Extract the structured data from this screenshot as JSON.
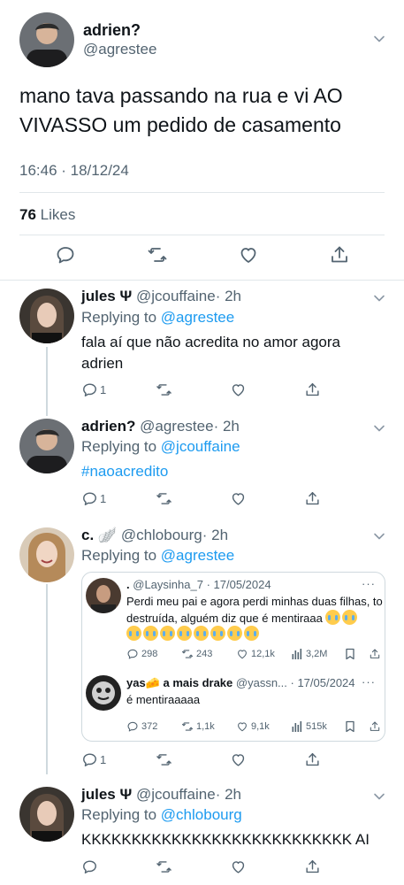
{
  "colors": {
    "link": "#1d9bf0",
    "secondary_text": "#536471",
    "primary_text": "#0f1419",
    "divider": "#e1e6ea"
  },
  "main_tweet": {
    "author_name": "adrien?",
    "author_handle": "@agrestee",
    "text": "mano tava passando na rua e vi AO VIVASSO um pedido de casamento",
    "timestamp": "16:46 · 18/12/24",
    "likes_count": "76",
    "likes_label": "Likes",
    "actions": [
      "reply-icon",
      "retweet-icon",
      "like-icon",
      "share-icon"
    ]
  },
  "replies": [
    {
      "name": "jules Ψ",
      "handle": "@jcouffaine",
      "time": "· 2h",
      "replying_label": "Replying to",
      "replying_to": "@agrestee",
      "text": "fala aí que não acredita no amor agora adrien",
      "reply_count": "1"
    },
    {
      "name": "adrien?",
      "handle": "@agrestee",
      "time": "· 2h",
      "replying_label": "Replying to",
      "replying_to": "@jcouffaine",
      "text": "#naoacredito",
      "reply_count": "1"
    },
    {
      "name": "c. 🪽",
      "handle": "@chlobourg",
      "time": "· 2h",
      "replying_label": "Replying to",
      "replying_to": "@agrestee",
      "reply_count": "1",
      "quote": {
        "first": {
          "name": ".",
          "handle": "@Laysinha_7",
          "date": "· 17/05/2024",
          "text": "Perdi meu pai e agora perdi minhas duas filhas, to destruída, alguém diz que é mentiraaa",
          "emoji_count": 10,
          "replies": "298",
          "retweets": "243",
          "likes": "12,1k",
          "views": "3,2M"
        },
        "second": {
          "name": "yas🧀 a mais drake",
          "handle": "@yassn...",
          "date": "· 17/05/2024",
          "text": "é mentiraaaaa",
          "replies": "372",
          "retweets": "1,1k",
          "likes": "9,1k",
          "views": "515k"
        }
      }
    },
    {
      "name": "jules Ψ",
      "handle": "@jcouffaine",
      "time": "· 2h",
      "replying_label": "Replying to",
      "replying_to": "@chlobourg",
      "text": "KKKKKKKKKKKKKKKKKKKKKKKKKKK AI"
    }
  ]
}
